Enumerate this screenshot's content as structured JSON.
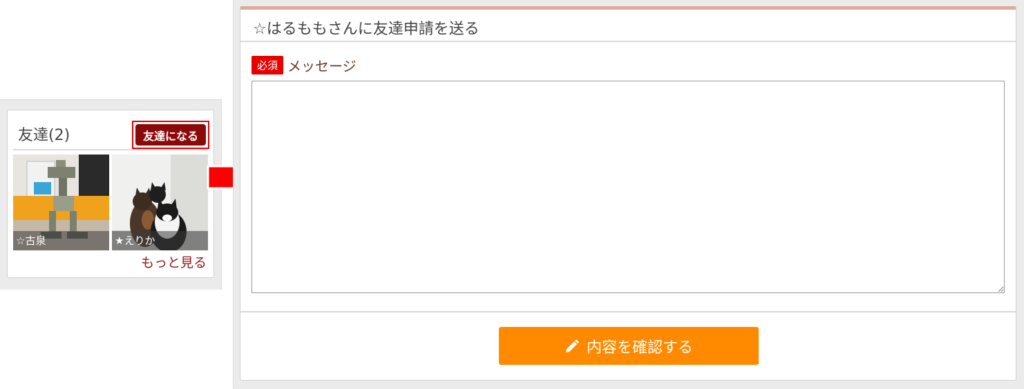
{
  "friends": {
    "title": "友達(2)",
    "add_friend_button": "友達になる",
    "items": [
      {
        "name": "☆古泉"
      },
      {
        "name": "★えりか"
      }
    ],
    "more_link": "もっと見る"
  },
  "form": {
    "title": "☆はるももさんに友達申請を送る",
    "required_badge": "必須",
    "message_label": "メッセージ",
    "message_value": "",
    "confirm_button": "内容を確認する",
    "icons": {
      "confirm": "pencil-icon",
      "arrow": "right-arrow-icon"
    }
  },
  "colors": {
    "add_friend_button_bg": "#8a0a0a",
    "highlight_outline": "#e00000",
    "required_badge": "#e60000",
    "confirm_button": "#ff8a00",
    "form_top_border": "#e0aa99",
    "link": "#8b1a1a"
  }
}
